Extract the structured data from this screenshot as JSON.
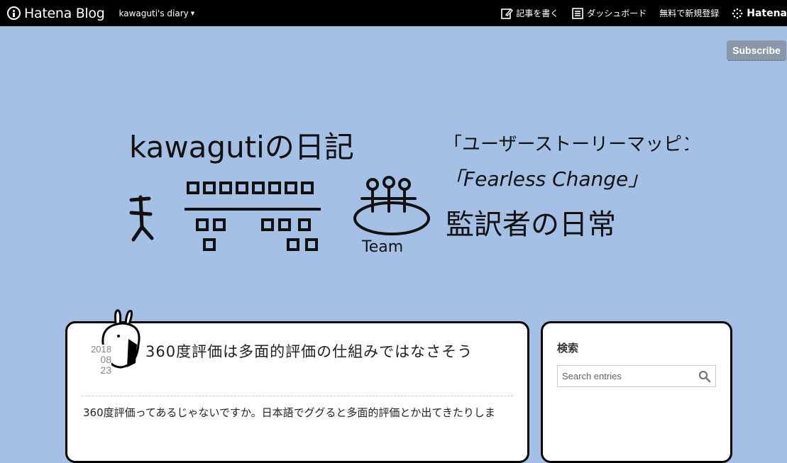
{
  "header": {
    "brand": "Hatena Blog",
    "diary": "kawaguti's diary",
    "write": "記事を書く",
    "dashboard": "ダッシュボード",
    "signup": "無料で新規登録",
    "hatena": "Hatena"
  },
  "subscribe": "Subscribe",
  "banner": {
    "line1": "kawagutiの日記",
    "line2": "「ユーザーストーリーマッピング」",
    "line3": "「Fearless Change」",
    "line4": "監訳者の日常",
    "team": "Team"
  },
  "entry": {
    "date_year": "2018",
    "date_month": "08",
    "date_day": "23",
    "title": "360度評価は多面的評価の仕組みではなさそう",
    "body": "360度評価ってあるじゃないですか。日本語でググると多面的評価とか出てきたりしま"
  },
  "sidebar": {
    "title": "検索",
    "search_placeholder": "Search entries"
  }
}
